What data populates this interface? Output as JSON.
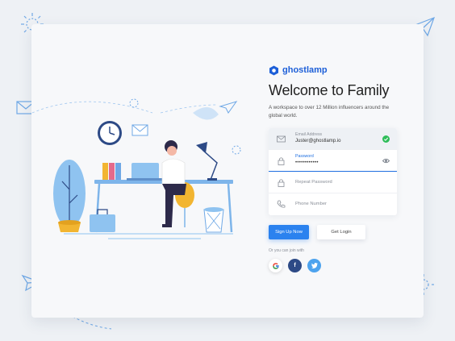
{
  "brand": {
    "name": "ghostlamp",
    "color": "#1d5fd8"
  },
  "header": {
    "title": "Welcome to Family",
    "subtitle": "A workspace to over 12 Million influencers around the global world."
  },
  "form": {
    "email": {
      "label": "Email Address",
      "value": "Juster@ghostlamp.io",
      "icon": "mail-icon",
      "status_icon": "check-circle-icon"
    },
    "password": {
      "label": "Password",
      "value": "••••••••••••",
      "icon": "lock-icon",
      "toggle_icon": "eye-icon"
    },
    "repeat_password": {
      "placeholder": "Repeat Password",
      "icon": "lock-icon"
    },
    "phone": {
      "placeholder": "Phone Number",
      "icon": "phone-icon"
    }
  },
  "buttons": {
    "signup": "Sign Up Now",
    "login": "Get Login"
  },
  "social": {
    "label": "Or you can join with",
    "providers": [
      {
        "name": "google",
        "glyph": "G"
      },
      {
        "name": "facebook",
        "glyph": "f"
      },
      {
        "name": "twitter",
        "glyph": "t"
      }
    ]
  },
  "colors": {
    "primary": "#2b82ef",
    "accent_blue": "#1f6fe0",
    "success": "#2ebd59",
    "illustration_blue": "#8fc3f0"
  }
}
